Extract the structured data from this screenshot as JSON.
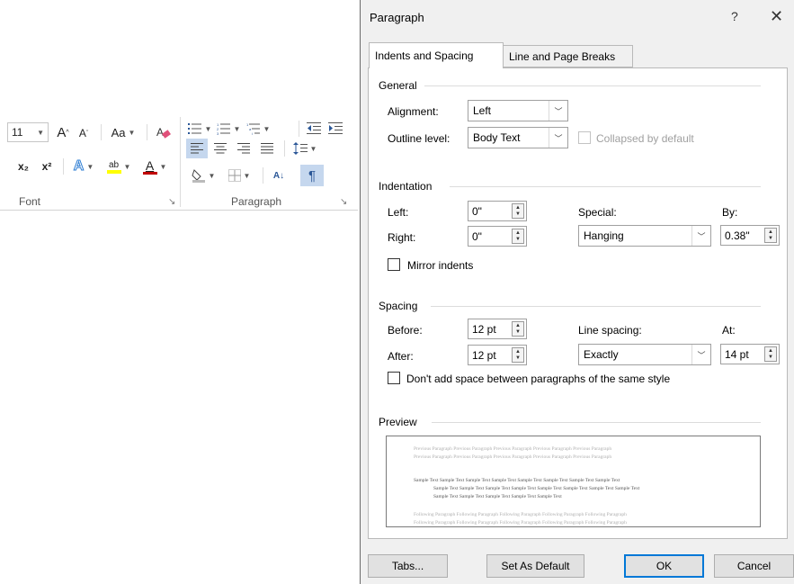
{
  "ribbon": {
    "font_size": "11",
    "case_label": "Aa",
    "highlight_glyph": "ab",
    "font_color_glyph": "A",
    "subscript": "x₂",
    "superscript": "x²",
    "sort_glyph": "A↓",
    "pilcrow": "¶",
    "font_group_label": "Font",
    "paragraph_group_label": "Paragraph",
    "highlight_color": "#ffff00",
    "font_color": "#c00000",
    "selected_color": "#c5d7ee"
  },
  "dialog": {
    "title": "Paragraph",
    "help": "?",
    "close": "✕",
    "tabs": [
      {
        "label": "Indents and Spacing",
        "active": true
      },
      {
        "label": "Line and Page Breaks",
        "active": false
      }
    ],
    "general": {
      "heading": "General",
      "alignment_label": "Alignment:",
      "alignment_value": "Left",
      "outline_label": "Outline level:",
      "outline_value": "Body Text",
      "collapsed_label": "Collapsed by default"
    },
    "indentation": {
      "heading": "Indentation",
      "left_label": "Left:",
      "left_value": "0\"",
      "right_label": "Right:",
      "right_value": "0\"",
      "special_label": "Special:",
      "special_value": "Hanging",
      "by_label": "By:",
      "by_value": "0.38\"",
      "mirror_label": "Mirror indents"
    },
    "spacing": {
      "heading": "Spacing",
      "before_label": "Before:",
      "before_value": "12 pt",
      "after_label": "After:",
      "after_value": "12 pt",
      "line_spacing_label": "Line spacing:",
      "line_spacing_value": "Exactly",
      "at_label": "At:",
      "at_value": "14 pt",
      "dont_add_label": "Don't add space between paragraphs of the same style"
    },
    "preview": {
      "heading": "Preview",
      "prev_1": "Previous Paragraph Previous Paragraph Previous Paragraph Previous Paragraph Previous Paragraph",
      "prev_2": "Previous Paragraph Previous Paragraph Previous Paragraph Previous Paragraph Previous Paragraph",
      "sample_1": "Sample Text Sample Text Sample Text Sample Text Sample Text Sample Text Sample Text Sample Text",
      "sample_2": "Sample Text Sample Text Sample Text Sample Text Sample Text Sample Text Sample Text Sample Text",
      "sample_3": "Sample Text Sample Text Sample Text Sample Text Sample Text",
      "follow_1": "Following Paragraph Following Paragraph Following Paragraph Following Paragraph Following Paragraph",
      "follow_2": "Following Paragraph Following Paragraph Following Paragraph Following Paragraph Following Paragraph"
    },
    "buttons": {
      "tabs": "Tabs...",
      "set_default": "Set As Default",
      "ok": "OK",
      "cancel": "Cancel"
    }
  }
}
